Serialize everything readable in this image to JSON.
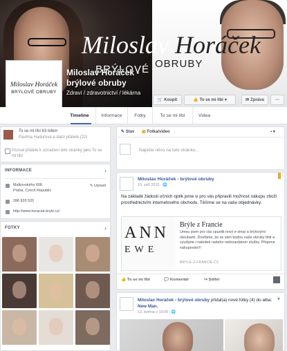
{
  "cover": {
    "title_light": "Miloslav",
    "title_dark": "Horáček",
    "subtitle_left": "BRÝLOVÉ",
    "subtitle_right": "OBRUBY"
  },
  "profile": {
    "logo_name": "Miloslav Horáček",
    "logo_sub": "BRÝLOVÉ OBRUBY",
    "page_name": "Miloslav Horáček - brýlové obruby",
    "category": "Zdraví / zdravotnictví / lékárna"
  },
  "cover_buttons": {
    "buy": "Koupit",
    "liked": "To se mi líbí",
    "message": "Zpráva",
    "more": "···"
  },
  "tabs": [
    "Timeline",
    "Informace",
    "Fotky",
    "To se mi líbí",
    "Videa"
  ],
  "likes": {
    "count_text": "To se mi líbí 63 lidem",
    "friends_text": "Pavlína Haduřová a další přátelé (22)",
    "invite_text": "Pozvat přátele k označení této stránky jako To se mi líbí"
  },
  "info": {
    "heading": "INFORMACE",
    "address_line1": "Malkovského 608",
    "address_line2": "Praha, Czech Republic",
    "edit": "Upravit",
    "phone": "286 920 520",
    "website": "http://www.horacek-bryle.cz/"
  },
  "photos": {
    "heading": "FOTKY",
    "thumbs": [
      {
        "bg": "#8b6a5c"
      },
      {
        "bg": "#e8e6e3"
      },
      {
        "bg": "#a88b73"
      },
      {
        "bg": "#4a3a36"
      },
      {
        "bg": "#d6c29a"
      },
      {
        "bg": "#6e5a50"
      },
      {
        "bg": "#c9b7a5"
      },
      {
        "bg": "#e3ddd6"
      },
      {
        "bg": "#7d6b60"
      }
    ]
  },
  "composer": {
    "status_tab": "Stav",
    "photo_tab": "Fotka/video",
    "placeholder": "Napište něco na tuto stránku..."
  },
  "post1": {
    "author": "Miloslav Horáček - brýlové obruby",
    "date": "15. září 2015 · 🌐",
    "text": "Na základě žádosti očních optik jsme si pro vás připravili možnost nákupu zboží prostřednictvím internetového obchodu. Těšíme se na vaše objednávky.",
    "link_image_line1": "ANN",
    "link_image_line2": "EWE",
    "link_title": "Brýle z Francie",
    "link_desc": "Umeu jsem pro vás spustili nový e-shop a brýlovými obrubami. Doufáme, že se vám budou naše obruby líbit a využijete i nabídek našeho nebízardatnér služby. Přejeme nakupování!!",
    "link_domain": "BRYLE-Z-FRANCIE.CZ",
    "like": "To se mi líbí",
    "comment": "Komentář",
    "share": "Sdílet"
  },
  "post2": {
    "author": "Miloslav Horáček - brýlové obruby",
    "action_text": "přidal(a) nové fotky (4) do alba:",
    "album": "New Man.",
    "date": "13. května v 19:09 · 🌐"
  }
}
